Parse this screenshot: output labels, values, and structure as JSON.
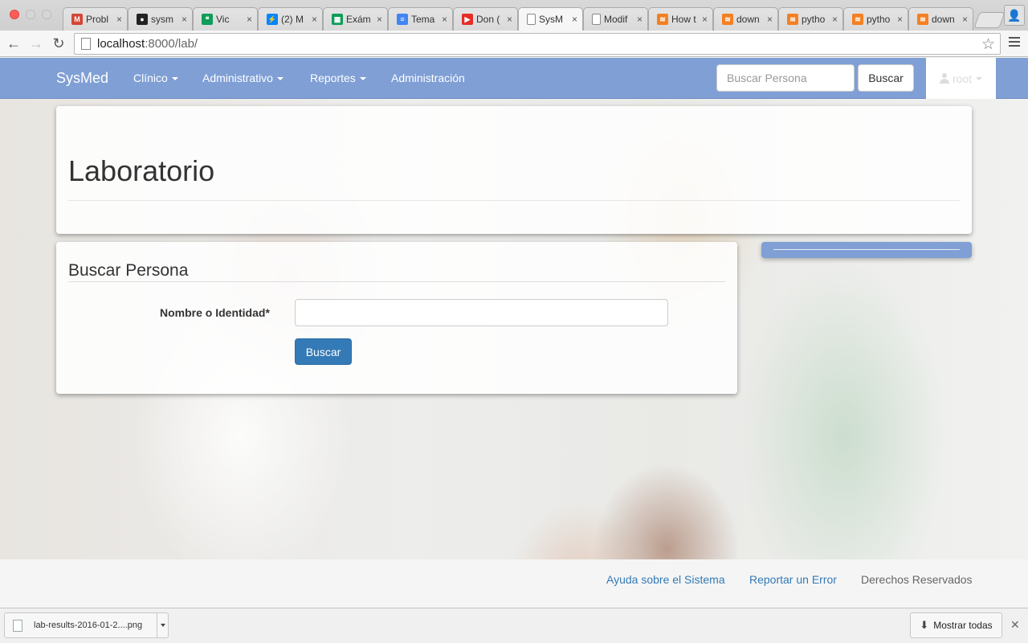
{
  "browser": {
    "tabs": [
      {
        "title": "Probl",
        "icon": "gmail-icon",
        "color": "#d44638",
        "glyph": "M"
      },
      {
        "title": "sysm",
        "icon": "github-icon",
        "color": "#222222",
        "glyph": "●"
      },
      {
        "title": "Vic",
        "icon": "hangouts-icon",
        "color": "#0f9d58",
        "glyph": "❝"
      },
      {
        "title": "(2) M",
        "icon": "messenger-icon",
        "color": "#0084ff",
        "glyph": "⚡"
      },
      {
        "title": "Exám",
        "icon": "sheets-icon",
        "color": "#0f9d58",
        "glyph": "▦"
      },
      {
        "title": "Tema",
        "icon": "docs-icon",
        "color": "#4285f4",
        "glyph": "≡"
      },
      {
        "title": "Don (",
        "icon": "youtube-icon",
        "color": "#e52d27",
        "glyph": "▶"
      },
      {
        "title": "SysM",
        "icon": "page-icon",
        "color": "#888888",
        "glyph": ""
      },
      {
        "title": "Modif",
        "icon": "page-icon",
        "color": "#888888",
        "glyph": ""
      },
      {
        "title": "How t",
        "icon": "stackoverflow-icon",
        "color": "#f48024",
        "glyph": "≋"
      },
      {
        "title": "down",
        "icon": "stackoverflow-icon",
        "color": "#f48024",
        "glyph": "≋"
      },
      {
        "title": "pytho",
        "icon": "stackoverflow-icon",
        "color": "#f48024",
        "glyph": "≋"
      },
      {
        "title": "pytho",
        "icon": "stackoverflow-icon",
        "color": "#f48024",
        "glyph": "≋"
      },
      {
        "title": "down",
        "icon": "stackoverflow-icon",
        "color": "#f48024",
        "glyph": "≋"
      }
    ],
    "active_tab": 7,
    "url_host": "localhost",
    "url_rest": ":8000/lab/"
  },
  "navbar": {
    "brand": "SysMed",
    "items": [
      "Clínico",
      "Administrativo",
      "Reportes",
      "Administración"
    ],
    "search_placeholder": "Buscar Persona",
    "search_button": "Buscar",
    "user": "root"
  },
  "main": {
    "title": "Laboratorio",
    "form": {
      "heading": "Buscar Persona",
      "field_label": "Nombre o Identidad*",
      "field_value": "",
      "submit": "Buscar"
    }
  },
  "footer": {
    "links": [
      "Ayuda sobre el Sistema",
      "Reportar un Error"
    ],
    "copyright": "Derechos Reservados"
  },
  "downloads": {
    "file": "lab-results-2016-01-2....png",
    "show_all": "Mostrar todas"
  },
  "colors": {
    "navbar": "#7f9fd5",
    "primary": "#337ab7",
    "link": "#337ab7"
  }
}
